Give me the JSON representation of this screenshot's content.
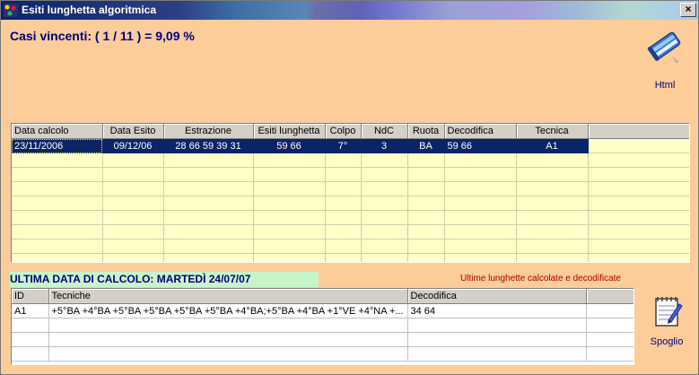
{
  "window": {
    "title": "Esiti lunghetta algoritmica",
    "close_label": "×"
  },
  "summary": {
    "casi_vincenti": "Casi vincenti: ( 1 / 11 ) = 9,09 %"
  },
  "toolbar": {
    "html_label": "Html",
    "spoglio_label": "Spoglio"
  },
  "results_table": {
    "columns": [
      "Data calcolo",
      "Data Esito",
      "Estrazione",
      "Esiti lunghetta",
      "Colpo",
      "NdC",
      "Ruota",
      "Decodifica",
      "Tecnica"
    ],
    "rows": [
      [
        "23/11/2006",
        "09/12/06",
        "28 66 59 39 31",
        "59 66",
        "7°",
        "3",
        "BA",
        "59 66",
        "A1"
      ]
    ]
  },
  "section": {
    "ultima_data": "ULTIMA DATA DI CALCOLO: MARTEDÌ 24/07/07",
    "ultime_label": "Ultime lunghette calcolate e decodificate"
  },
  "last_table": {
    "columns": [
      "ID",
      "Tecniche",
      "Decodifica"
    ],
    "rows": [
      [
        "A1",
        "+5°BA +4°BA +5°BA +5°BA +5°BA +5°BA +4°BA;+5°BA +4°BA +1°VE +4°NA +...",
        "34 64"
      ]
    ]
  },
  "colors": {
    "background": "#fccc99",
    "grid_bg": "#ffffc8",
    "selection": "#0a246a",
    "heading_text": "#00007f",
    "label_red": "#b00000",
    "ultima_bg": "#c8f5c8"
  },
  "icons": {
    "app": "app-icon",
    "html": "book-icon",
    "spoglio": "notepad-icon"
  }
}
